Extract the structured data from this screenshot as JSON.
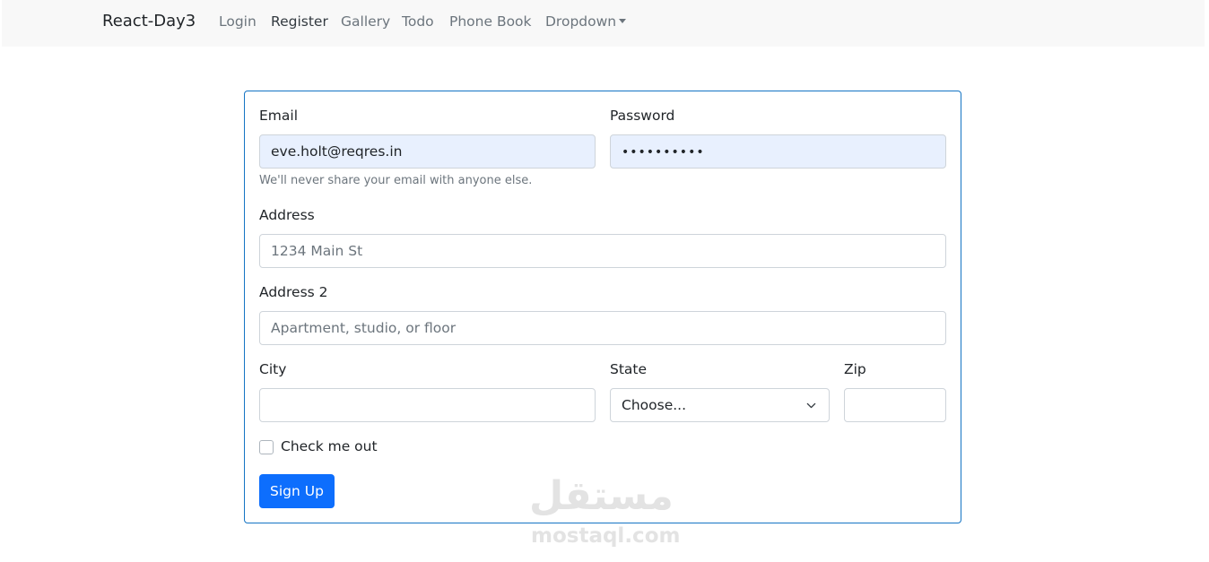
{
  "navbar": {
    "brand": "React-Day3",
    "items": [
      {
        "label": "Login",
        "active": false
      },
      {
        "label": "Register",
        "active": true
      },
      {
        "label": "Gallery",
        "active": false
      },
      {
        "label": "Todo",
        "active": false
      },
      {
        "label": "Phone Book",
        "active": false
      },
      {
        "label": "Dropdown",
        "active": false
      }
    ]
  },
  "form": {
    "email": {
      "label": "Email",
      "value": "eve.holt@reqres.in",
      "help": "We'll never share your email with anyone else."
    },
    "password": {
      "label": "Password",
      "value": "••••••••••"
    },
    "address": {
      "label": "Address",
      "placeholder": "1234 Main St"
    },
    "address2": {
      "label": "Address 2",
      "placeholder": "Apartment, studio, or floor"
    },
    "city": {
      "label": "City",
      "value": ""
    },
    "state": {
      "label": "State",
      "selected": "Choose..."
    },
    "zip": {
      "label": "Zip",
      "value": ""
    },
    "checkbox": {
      "label": "Check me out",
      "checked": false
    },
    "submit": {
      "label": "Sign Up"
    }
  },
  "watermark": {
    "arabic": "مستقل",
    "latin": "mostaql.com"
  },
  "colors": {
    "accent": "#0d6efd",
    "card_border": "#1474c4",
    "autofill": "#e8f0fe"
  }
}
